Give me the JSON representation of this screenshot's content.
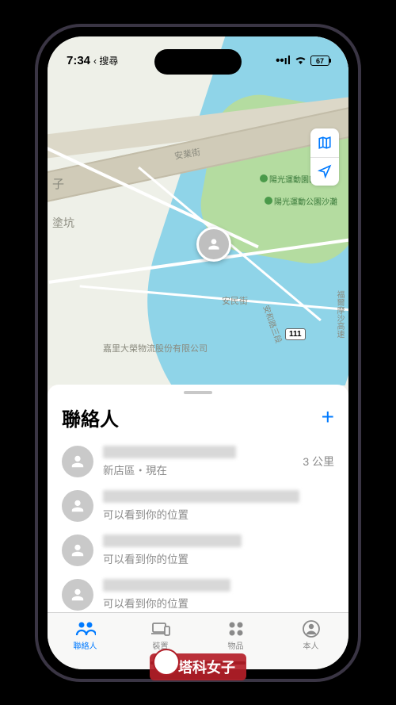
{
  "status_bar": {
    "time": "7:34",
    "back_label": "搜尋",
    "battery_pct": "67"
  },
  "map": {
    "labels": {
      "street1": "安業街",
      "street2": "安民街",
      "street3": "安和路三段",
      "area_left1": "子",
      "area_left2": "塗坑",
      "highway_right": "福爾摩沙高速",
      "poi_company": "嘉里大榮物流股份有限公司"
    },
    "route_badge": "111",
    "pois": [
      {
        "name": "陽光運動園區"
      },
      {
        "name": "陽光運動公園沙灘"
      }
    ]
  },
  "sheet": {
    "title": "聯絡人",
    "add_label": "+",
    "contacts": [
      {
        "subtitle": "新店區・現在",
        "distance": "3 公里"
      },
      {
        "subtitle": "可以看到你的位置",
        "distance": ""
      },
      {
        "subtitle": "可以看到你的位置",
        "distance": ""
      },
      {
        "subtitle": "可以看到你的位置",
        "distance": ""
      }
    ]
  },
  "tabs": [
    {
      "label": "聯絡人",
      "active": true
    },
    {
      "label": "裝置",
      "active": false
    },
    {
      "label": "物品",
      "active": false
    },
    {
      "label": "本人",
      "active": false
    }
  ],
  "watermark": "塔科女子"
}
